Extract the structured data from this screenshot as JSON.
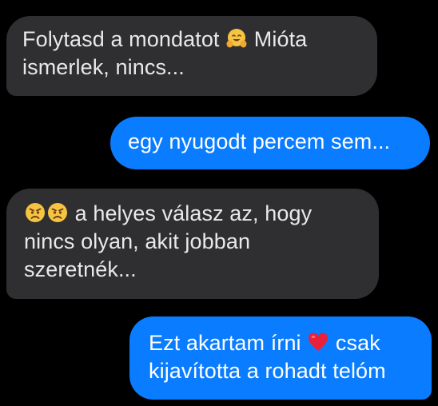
{
  "messages": [
    {
      "direction": "received",
      "line1_text": "Folytasd a mondatot",
      "line1_emoji": "hugging-face-icon",
      "line1_after": "Mióta",
      "line2": "ismerlek, nincs..."
    },
    {
      "direction": "sent",
      "text": "egy nyugodt percem sem..."
    },
    {
      "direction": "received",
      "line1_emojis": [
        "pouting-face-icon",
        "pouting-face-icon"
      ],
      "line1_text": "a helyes válasz az, hogy",
      "line2": "nincs olyan, akit jobban",
      "line3": "szeretnék..."
    },
    {
      "direction": "sent",
      "line1_text": "Ezt akartam írni",
      "line1_emoji": "red-heart-icon",
      "line1_after": "csak",
      "line2": "kijavította a rohadt telóm"
    }
  ],
  "colors": {
    "background": "#000000",
    "received_bubble": "#2f2f31",
    "received_text": "#e9e9eb",
    "sent_bubble": "#0a7cff",
    "sent_text": "#ffffff"
  }
}
